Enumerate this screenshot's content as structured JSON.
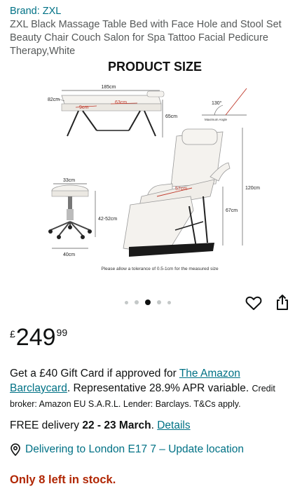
{
  "brand": "Brand: ZXL",
  "title": "ZXL Black Massage Table Bed with Face Hole and Stool Set Beauty Chair Couch Salon for Spa Tattoo Facial Pedicure Therapy,White",
  "image": {
    "heading": "PRODUCT SIZE",
    "dims": {
      "bed_length": "185cm",
      "bed_width": "82cm",
      "face_hole": "9cm",
      "back_rest": "63cm",
      "bed_height": "65cm",
      "angle": "130°",
      "angle_caption": "Maximum Angle",
      "stool_top": "33cm",
      "stool_height": "42-52cm",
      "stool_base": "40cm",
      "seat": "57cm",
      "chair_height": "120cm",
      "seat_height": "67cm"
    },
    "tolerance_note": "Please allow a tolerance of 0.5-1cm for the measured size"
  },
  "carousel": {
    "count": 5,
    "active_index": 2
  },
  "icons": {
    "wishlist": "heart-icon",
    "share": "share-icon",
    "location": "location-pin-icon"
  },
  "price": {
    "currency": "£",
    "whole": "249",
    "fraction": "99"
  },
  "promo": {
    "lead": "Get a £40 Gift Card if approved for ",
    "link": "The Amazon Barclaycard",
    "rest": ". Representative 28.9% APR variable. ",
    "small": "Credit broker: Amazon EU S.A.R.L. Lender: Barclays. T&Cs apply."
  },
  "delivery": {
    "lead": "FREE delivery ",
    "dates": "22 - 23 March",
    "sep": ". ",
    "link": "Details"
  },
  "location": {
    "text": "Delivering to London E17 7 – Update location"
  },
  "stock": "Only 8 left in stock.",
  "colors": {
    "link": "#007185",
    "alert": "#b12704",
    "text": "#0f1111",
    "muted": "#565959",
    "dimension_red": "#c0392b"
  }
}
